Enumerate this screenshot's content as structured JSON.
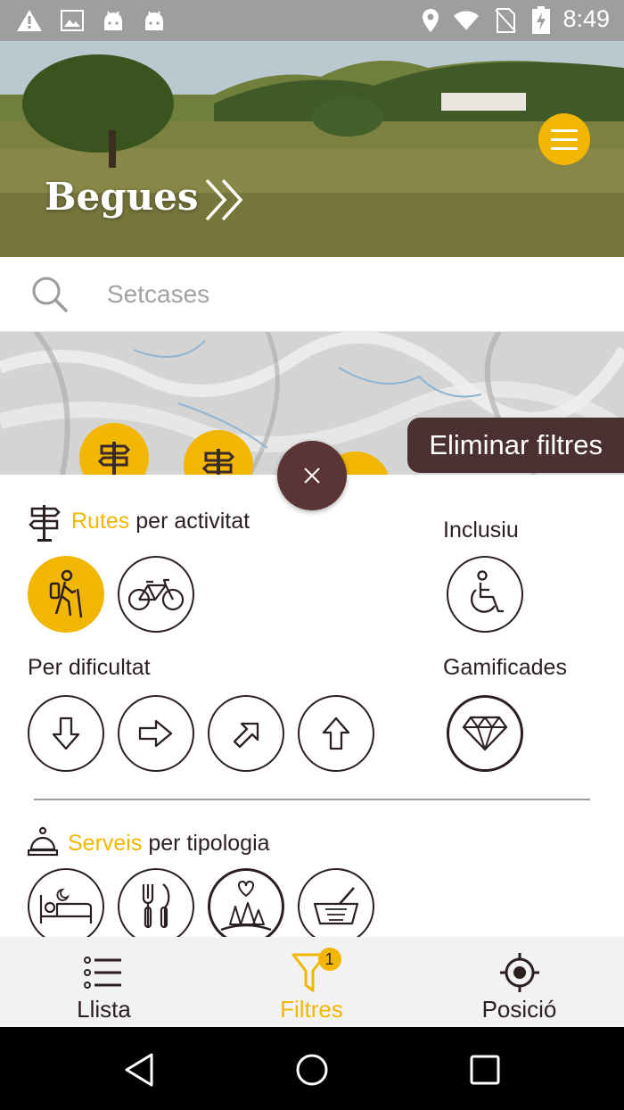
{
  "status_bar": {
    "time": "8:49",
    "left_icons": [
      "warning-icon",
      "image-icon",
      "android-icon",
      "android-icon"
    ],
    "right_icons": [
      "location-icon",
      "wifi-icon",
      "no-sim-icon",
      "battery-charging-icon"
    ]
  },
  "hero": {
    "title": "Begues",
    "background": "landscape-photo"
  },
  "search": {
    "placeholder": "Setcases"
  },
  "map": {
    "clear_filters_label": "Eliminar filtres"
  },
  "filters": {
    "routes": {
      "accent": "Rutes",
      "rest": " per activitat",
      "activities": [
        {
          "icon": "hiking-icon",
          "active": true
        },
        {
          "icon": "bicycle-icon",
          "active": false
        }
      ]
    },
    "inclusive": {
      "label": "Inclusiu",
      "icon": "wheelchair-icon"
    },
    "difficulty": {
      "label": "Per dificultat",
      "levels": [
        "arrow-down-icon",
        "arrow-right-icon",
        "arrow-up-right-icon",
        "arrow-up-icon"
      ]
    },
    "gamified": {
      "label": "Gamificades",
      "icon": "diamond-icon"
    },
    "services": {
      "accent": "Serveis",
      "rest": " per tipologia",
      "types": [
        "bed-icon",
        "cutlery-icon",
        "nature-icon",
        "basket-icon"
      ]
    }
  },
  "bottom_nav": {
    "items": [
      {
        "label": "Llista",
        "icon": "list-icon",
        "active": false
      },
      {
        "label": "Filtres",
        "icon": "filter-icon",
        "active": true,
        "badge": "1"
      },
      {
        "label": "Posició",
        "icon": "crosshair-icon",
        "active": false
      }
    ]
  },
  "colors": {
    "accent": "#f2b705",
    "dark": "#4a3030",
    "text": "#2b1f1f"
  }
}
